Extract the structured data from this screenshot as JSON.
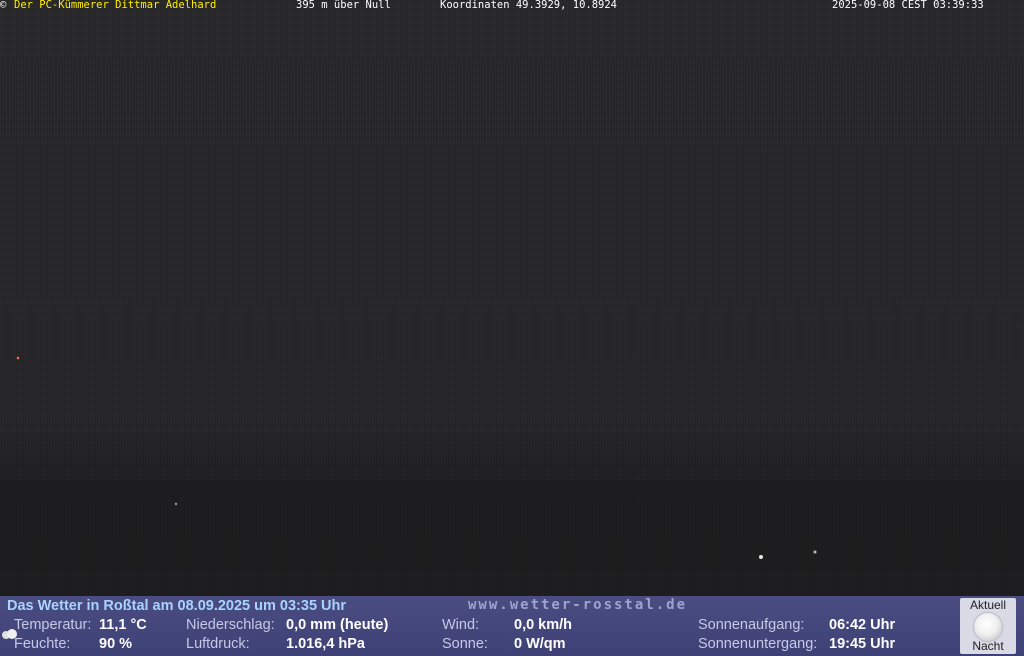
{
  "header": {
    "copyright": "©",
    "owner": "Der PC-Kümmerer Dittmar Adelhard",
    "altitude": "395 m über Null",
    "coordinates": "Koordinaten 49.3929, 10.8924",
    "timestamp": "2025-09-08 CEST 03:39:33"
  },
  "panel": {
    "title": "Das Wetter in Roßtal am 08.09.2025 um 03:35 Uhr",
    "url": "www.wetter-rosstal.de",
    "temperature": {
      "label": "Temperatur:",
      "value": "11,1 °C"
    },
    "humidity": {
      "label": "Feuchte:",
      "value": "90 %"
    },
    "precipitation": {
      "label": "Niederschlag:",
      "value": "0,0 mm (heute)"
    },
    "pressure": {
      "label": "Luftdruck:",
      "value": "1.016,4 hPa"
    },
    "wind": {
      "label": "Wind:",
      "value": "0,0 km/h"
    },
    "sun": {
      "label": "Sonne:",
      "value": "0 W/qm"
    },
    "sunrise": {
      "label": "Sonnenaufgang:",
      "value": "06:42 Uhr"
    },
    "sunset": {
      "label": "Sonnenuntergang:",
      "value": "19:45 Uhr"
    },
    "moon": {
      "top_label": "Aktuell",
      "bottom_label": "Nacht",
      "icon": "moon-icon"
    }
  },
  "colors": {
    "header_highlight": "#ffee00",
    "panel_bg": "#45477c",
    "title_color": "#a8d4ff"
  }
}
